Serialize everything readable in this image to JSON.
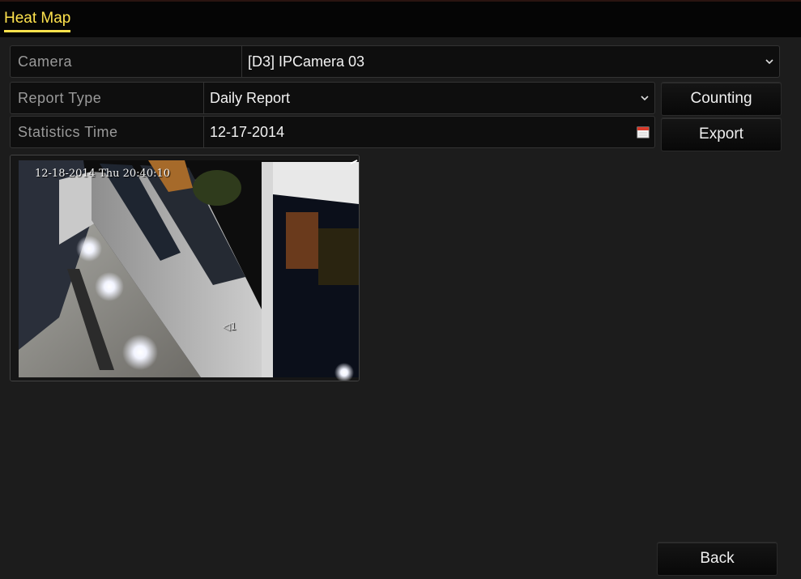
{
  "header": {
    "title": "Heat Map"
  },
  "camera": {
    "label": "Camera",
    "value": "[D3] IPCamera 03"
  },
  "report_type": {
    "label": "Report Type",
    "value": "Daily Report"
  },
  "statistics_time": {
    "label": "Statistics Time",
    "value": "12-17-2014"
  },
  "buttons": {
    "counting": "Counting",
    "export": "Export",
    "back": "Back"
  },
  "preview": {
    "osd_timestamp": "12-18-2014 Thu 20:40:10",
    "channel_label": "1"
  },
  "colors": {
    "accent": "#ffe34d",
    "background": "#1c1c1c",
    "field": "#0e0e0e"
  },
  "icons": [
    "chevron-down-icon",
    "calendar-icon",
    "speaker-icon"
  ]
}
